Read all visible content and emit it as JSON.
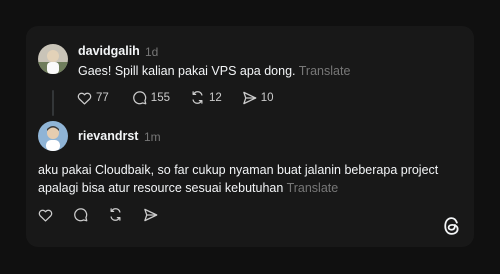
{
  "posts": [
    {
      "username": "davidgalih",
      "time": "1d",
      "text": "Gaes! Spill kalian pakai VPS apa dong.",
      "translate": "Translate",
      "likes": "77",
      "replies": "155",
      "reposts": "12",
      "shares": "10"
    },
    {
      "username": "rievandrst",
      "time": "1m",
      "text_line1": "aku pakai Cloudbaik, so far cukup nyaman buat jalanin beberapa project",
      "text_line2": "apalagi bisa atur resource sesuai kebutuhan",
      "translate": "Translate"
    }
  ],
  "icons": {
    "like": "heart-icon",
    "reply": "comment-icon",
    "repost": "repost-icon",
    "share": "send-icon",
    "brand": "threads-logo-icon"
  },
  "colors": {
    "background": "#101010",
    "card": "#181818",
    "text": "#f3f5f7",
    "muted": "#777777"
  }
}
